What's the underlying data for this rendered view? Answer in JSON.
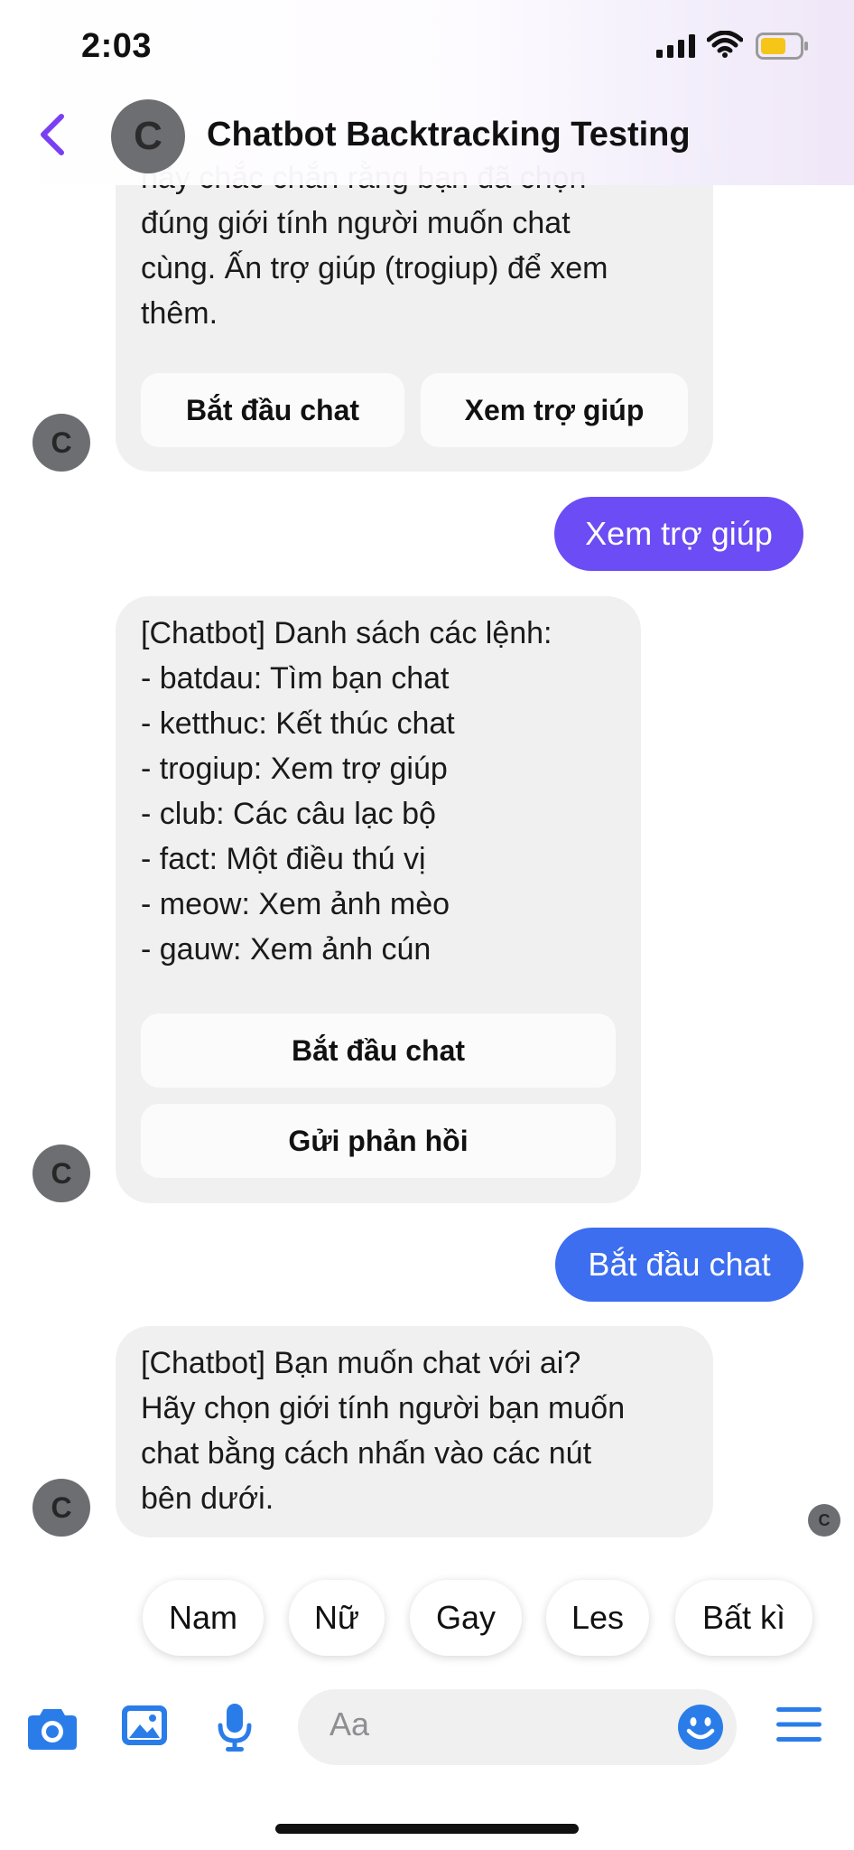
{
  "status_bar": {
    "time": "2:03"
  },
  "header": {
    "avatar_letter": "C",
    "title": "Chatbot Backtracking Testing"
  },
  "messages": [
    {
      "from": "bot",
      "partial_top_line": "hãy chắc chắn rằng bạn đã chọn",
      "text": "đúng giới tính người muốn chat\ncùng. Ấn trợ giúp (trogiup) để xem\nthêm.",
      "buttons": [
        "Bắt đầu chat",
        "Xem trợ giúp"
      ],
      "avatar_letter": "C"
    },
    {
      "from": "user",
      "text": "Xem trợ giúp"
    },
    {
      "from": "bot",
      "text": "[Chatbot] Danh sách các lệnh:\n- batdau: Tìm bạn chat\n- ketthuc: Kết thúc chat\n- trogiup: Xem trợ giúp\n- club: Các câu lạc bộ\n- fact: Một điều thú vị\n- meow: Xem ảnh mèo\n- gauw: Xem ảnh cún",
      "buttons": [
        "Bắt đầu chat",
        "Gửi phản hồi"
      ],
      "avatar_letter": "C"
    },
    {
      "from": "user",
      "text": "Bắt đầu chat"
    },
    {
      "from": "bot",
      "text": "[Chatbot] Bạn muốn chat với ai?\nHãy chọn giới tính người bạn muốn\nchat bằng cách nhấn vào các nút\nbên dưới.",
      "avatar_letter": "C",
      "read_receipt_letter": "C"
    }
  ],
  "quick_replies": [
    "Nam",
    "Nữ",
    "Gay",
    "Les",
    "Bất kì"
  ],
  "composer": {
    "placeholder": "Aa",
    "icons": [
      "camera-icon",
      "image-icon",
      "microphone-icon",
      "emoji-icon",
      "menu-icon"
    ]
  },
  "colors": {
    "accent_purple": "#7a3ff2",
    "user_bubble_violet": "#6c4cf4",
    "user_bubble_blue": "#3d6ef0",
    "icon_blue": "#2a7de9",
    "bot_bubble": "#f0f0f0"
  }
}
